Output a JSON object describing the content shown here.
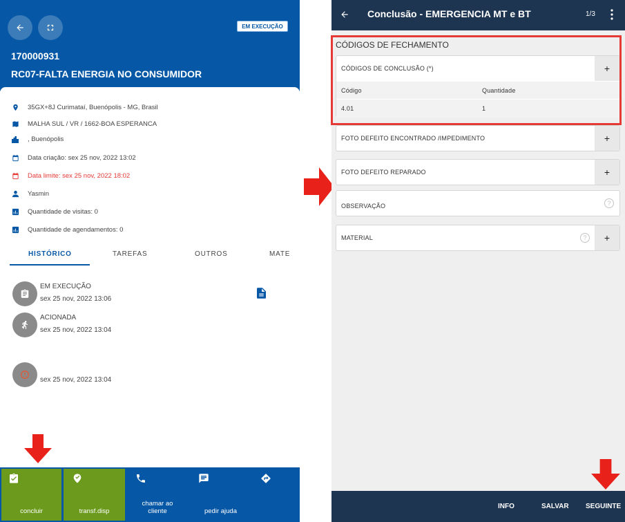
{
  "left": {
    "status_badge": "EM EXECUÇÃO",
    "order_number": "170000931",
    "order_title": "RC07-FALTA ENERGIA NO CONSUMIDOR",
    "info": [
      {
        "icon": "location-pin-icon",
        "text": "35GX+8J Curimataí, Buenópolis - MG, Brasil"
      },
      {
        "icon": "map-icon",
        "text": "MALHA SUL / VR / 1662-BOA ESPERANCA"
      },
      {
        "icon": "city-icon",
        "text": ", Buenópolis"
      },
      {
        "icon": "calendar-icon",
        "text": "Data criação: sex 25 nov, 2022 13:02"
      },
      {
        "icon": "calendar-icon",
        "text": "Data limite: sex 25 nov, 2022 18:02"
      },
      {
        "icon": "person-icon",
        "text": "Yasmin"
      },
      {
        "icon": "bar-chart-icon",
        "text": "Quantidade de visitas: 0"
      },
      {
        "icon": "bar-chart-icon",
        "text": "Quantidade de agendamentos: 0"
      }
    ],
    "tabs": [
      "HISTÓRICO",
      "TAREFAS",
      "OUTROS",
      "MATE"
    ],
    "history": [
      {
        "status": "EM EXECUÇÃO",
        "date": "sex 25 nov, 2022 13:06"
      },
      {
        "status": "ACIONADA",
        "date": "sex 25 nov, 2022 13:04"
      },
      {
        "status": "",
        "date": "sex 25 nov, 2022 13:04"
      }
    ],
    "actions": [
      {
        "label": "concluir",
        "icon": "clipboard-check-icon"
      },
      {
        "label": "transf.disp",
        "icon": "transfer-icon"
      },
      {
        "label": "chamar ao cliente",
        "line1": "chamar ao",
        "line2": "cliente",
        "icon": "phone-icon"
      },
      {
        "label": "pedir ajuda",
        "icon": "chat-icon"
      },
      {
        "label": "",
        "icon": "directions-icon"
      }
    ]
  },
  "right": {
    "title": "Conclusão - EMERGENCIA MT e BT",
    "page": "1/3",
    "section_title": "CÓDIGOS DE FECHAMENTO",
    "codes_card": {
      "label": "CÓDIGOS DE CONCLUSÃO (*)",
      "columns": [
        "Código",
        "Quantidade"
      ],
      "rows": [
        [
          "4.01",
          "1"
        ]
      ]
    },
    "cards": [
      {
        "label": "FOTO DEFEITO ENCONTRADO /IMPEDIMENTO"
      },
      {
        "label": "FOTO DEFEITO REPARADO"
      },
      {
        "label": "OBSERVAÇÃO"
      },
      {
        "label": "MATERIAL"
      }
    ],
    "footer": {
      "info": "INFO",
      "save": "SALVAR",
      "next": "SEGUINTE"
    }
  },
  "colors": {
    "primary_blue": "#0658a6",
    "dark_navy": "#1e3552",
    "action_green": "#6b9a1c",
    "alert_red": "#e53935"
  }
}
